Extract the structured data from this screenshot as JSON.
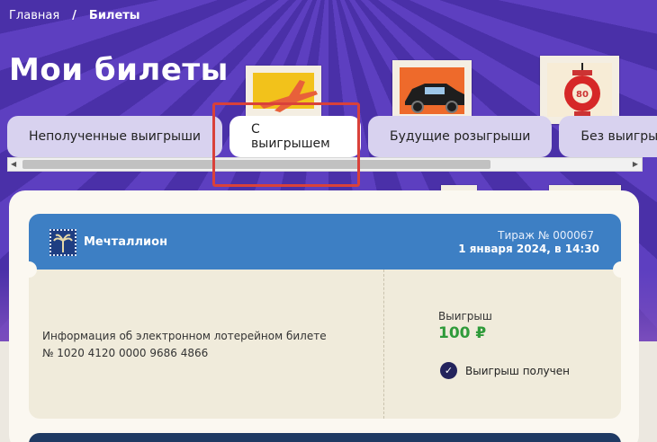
{
  "breadcrumb": {
    "home": "Главная",
    "separator": "/",
    "current": "Билеты"
  },
  "page_title": "Мои билеты",
  "tabs": [
    {
      "label": "Неполученные выигрыши",
      "active": false
    },
    {
      "label": "С выигрышем",
      "active": true
    },
    {
      "label": "Будущие розыгрыши",
      "active": false
    },
    {
      "label": "Без выигрыша",
      "active": false
    }
  ],
  "ticket": {
    "brand": "Мечталлион",
    "draw_number": "Тираж № 000067",
    "draw_date": "1 января 2024, в 14:30",
    "info_title": "Информация об электронном лотерейном билете",
    "ticket_number": "№ 1020 4120 0000 9686 4866",
    "win_label": "Выигрыш",
    "win_amount": "100 ₽",
    "status": "Выигрыш получен"
  },
  "stamps": {
    "lantern_number": "80"
  },
  "colors": {
    "hero_purple": "#5d3fc0",
    "ticket_blue": "#3d7fc4",
    "win_green": "#2f9b3a",
    "highlight_red": "#d9413a"
  },
  "icons": [
    "palm-logo-icon",
    "checkmark-icon",
    "airplane-stamp-icon",
    "car-stamp-icon",
    "lantern-stamp-icon"
  ]
}
